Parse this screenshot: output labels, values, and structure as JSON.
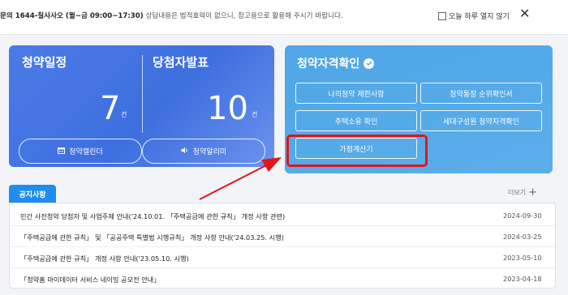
{
  "topbar": {
    "message_strong": "문의 1644-칠사사오 (월~금 09:00~17:30)",
    "message_sub": " 상담내용은 법적효력이 없으니, 참고용으로 활용해 주시기 바랍니다.",
    "no_show_today": "오늘 하루 열지 않기",
    "close_icon": "close-icon"
  },
  "schedule_card": {
    "title_left": "청약일정",
    "title_right": "당첨자발표",
    "count_left": "7",
    "count_right": "10",
    "unit": "건",
    "calendar_button": "청약캘린더",
    "alert_button": "청약알리미"
  },
  "qualification_card": {
    "title": "청약자격확인",
    "buttons": [
      "나의청약 제한사항",
      "청약통장 순위확인서",
      "주택소유 확인",
      "세대구성원 청약자격확인",
      "가점계산기"
    ],
    "highlight_color": "#e3141c"
  },
  "notice": {
    "tab_label": "공지사항",
    "more_label": "더보기",
    "rows": [
      {
        "title": "민간 사전청약 당첨자 및 사업주체 안내('24.10.01. 「주택공급에 관한 규칙」 개정 사항 관련)",
        "date": "2024-09-30"
      },
      {
        "title": "「주택공급에 관한 규칙」 및 「공공주택 특별법 시행규칙」 개정 사항 안내('24.03.25. 시행)",
        "date": "2024-03-25"
      },
      {
        "title": "「주택공급에 관한 규칙」 개정 사항 안내('23.05.10. 시행)",
        "date": "2023-05-10"
      },
      {
        "title": "「청약홈 마이데이터 서비스 네이밍 공모전 안내」",
        "date": "2023-04-18"
      }
    ]
  },
  "colors": {
    "schedule_card": "#4b7be6",
    "qualification_card": "#4fa6e6",
    "notice_tab": "#1f8ded",
    "arrow": "#e3141c"
  }
}
